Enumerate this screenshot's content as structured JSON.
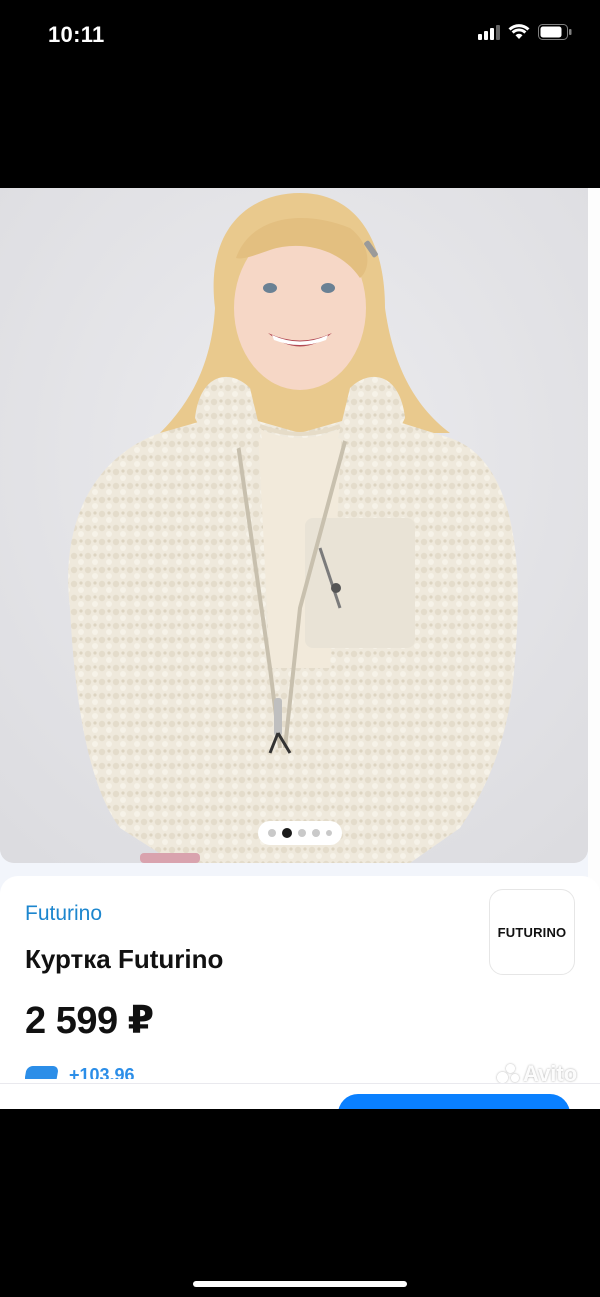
{
  "status_bar": {
    "time": "10:11",
    "icons": [
      "cellular-signal-icon",
      "wifi-icon",
      "battery-icon"
    ]
  },
  "gallery": {
    "image_subject": "product-photo",
    "page_indicator": {
      "count": 5,
      "active_index": 1
    }
  },
  "product": {
    "brand": "Futurino",
    "title": "Куртка Futurino",
    "price": "2 599 ₽",
    "brand_logo_text": "FUTURINO",
    "bonus_partial": "+103,96"
  },
  "watermark": "Avito",
  "colors": {
    "accent": "#0a80ff",
    "brand_link": "#1c86ce",
    "text": "#111111",
    "background": "#f2f5fb"
  }
}
